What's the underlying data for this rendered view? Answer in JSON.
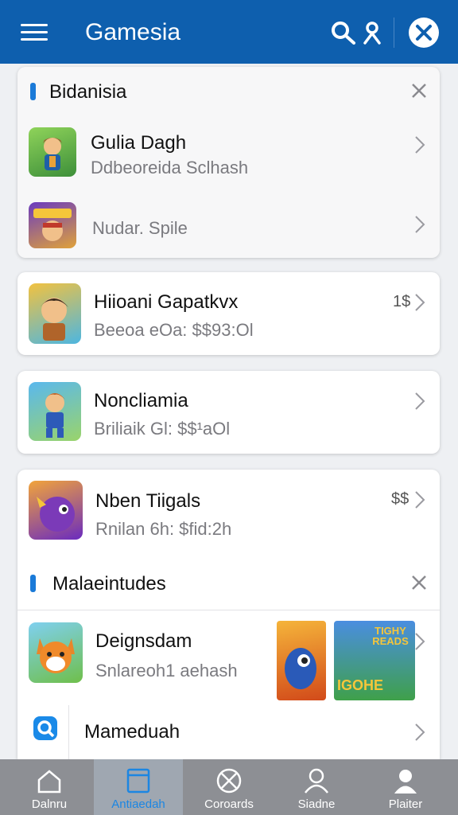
{
  "header": {
    "title": "Gamesia"
  },
  "section1": {
    "title": "Bidanisia",
    "items": [
      {
        "title": "Gulia Dagh",
        "subtitle": "Ddbeoreida Sclhash"
      },
      {
        "title": "",
        "subtitle": "Nudar. Spile"
      }
    ]
  },
  "card2": {
    "title": "Hiioani Gapatkvx",
    "subtitle": "Beeoa eOa: $$93:Ol",
    "price": "1$"
  },
  "card3": {
    "title": "Noncliamia",
    "subtitle": "Briliaik Gl: $$¹aOl"
  },
  "card4": {
    "item": {
      "title": "Nben Tiigals",
      "subtitle": "Rnilan 6h: $fid:2h",
      "price": "$$"
    },
    "section_title": "Malaeintudes",
    "items": [
      {
        "title": "Deignsdam",
        "subtitle": "Snlareoh1 aehash",
        "banner_text_1": "TIGHY\nREADS",
        "banner_text_2": "IGOHE"
      },
      {
        "title": "Mameduah"
      }
    ]
  },
  "bottom_nav": [
    {
      "label": "Dalnru",
      "icon": "home-icon",
      "active": false
    },
    {
      "label": "Antiaedah",
      "icon": "page-icon",
      "active": true
    },
    {
      "label": "Coroards",
      "icon": "ball-icon",
      "active": false
    },
    {
      "label": "Siadne",
      "icon": "user-outline-icon",
      "active": false
    },
    {
      "label": "Plaiter",
      "icon": "user-filled-icon",
      "active": false
    }
  ],
  "colors": {
    "header": "#0e5fae",
    "accent": "#1a7ad8",
    "nav_bg": "#8d8f94"
  }
}
